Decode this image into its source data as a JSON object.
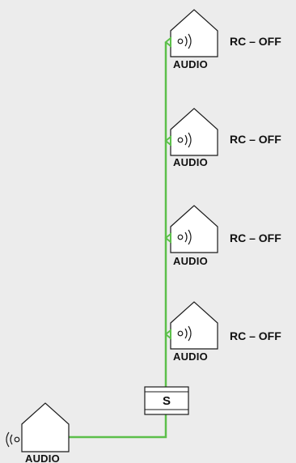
{
  "devices": [
    {
      "id": "dev1",
      "label": "AUDIO",
      "status": "RC – OFF",
      "icon": "audio-out-icon"
    },
    {
      "id": "dev2",
      "label": "AUDIO",
      "status": "RC – OFF",
      "icon": "audio-out-icon"
    },
    {
      "id": "dev3",
      "label": "AUDIO",
      "status": "RC – OFF",
      "icon": "audio-out-icon"
    },
    {
      "id": "dev4",
      "label": "AUDIO",
      "status": "RC – OFF",
      "icon": "audio-out-icon"
    }
  ],
  "source": {
    "label": "AUDIO",
    "icon": "audio-in-icon"
  },
  "switch": {
    "label": "S"
  },
  "colors": {
    "wire": "#5cbf4a",
    "outline": "#1a1a1a",
    "house_fill": "#ffffff",
    "background": "#ececec",
    "switch_fill": "#ffffff"
  }
}
